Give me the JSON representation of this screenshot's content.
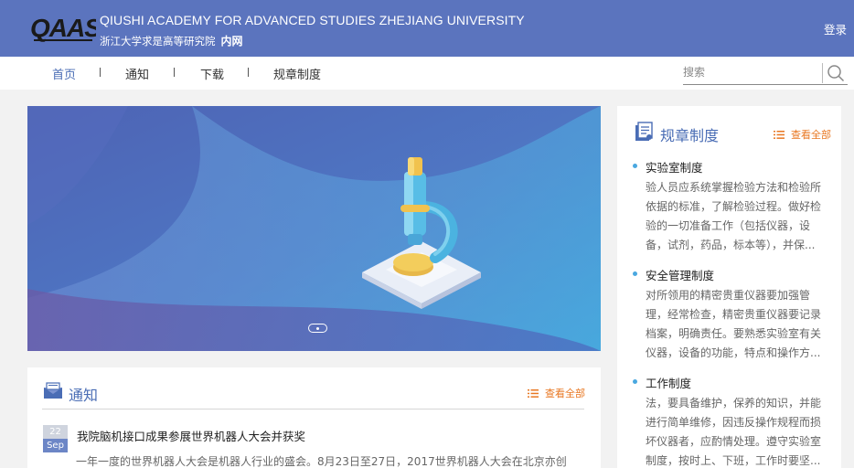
{
  "header": {
    "logo_text": "QAAS",
    "title_en": "QIUSHI ACADEMY FOR ADVANCED STUDIES ZHEJIANG UNIVERSITY",
    "title_cn": "浙江大学求是高等研究院",
    "badge": "内网",
    "login_label": "登录"
  },
  "nav": {
    "items": [
      {
        "label": "首页",
        "active": true
      },
      {
        "label": "通知",
        "active": false
      },
      {
        "label": "下载",
        "active": false
      },
      {
        "label": "规章制度",
        "active": false
      }
    ],
    "search_placeholder": "搜索",
    "search_icon": "search-icon"
  },
  "banner": {
    "illustration": "microscope",
    "slide_indicator_active": 1
  },
  "notice": {
    "title": "通知",
    "more_label": "查看全部",
    "items": [
      {
        "day": "22",
        "month": "Sep",
        "title": "我院脑机接口成果参展世界机器人大会并获奖",
        "summary": "一年一度的世界机器人大会是机器人行业的盛会。8月23日至27日，2017世界机器人大会在北京亦创"
      }
    ]
  },
  "rules": {
    "title": "规章制度",
    "more_label": "查看全部",
    "items": [
      {
        "title": "实验室制度",
        "lines": [
          "验人员应系统掌握检验方法和检验所",
          "依据的标准，了解检验过程。做好检",
          "验的一切准备工作（包括仪器，设",
          "备，试剂，药品，标本等），并保..."
        ]
      },
      {
        "title": "安全管理制度",
        "lines": [
          "对所领用的精密贵重仪器要加强管",
          "理，经常检查，精密贵重仪器要记录",
          "档案，明确责任。要熟悉实验室有关",
          "仪器，设备的功能，特点和操作方..."
        ]
      },
      {
        "title": "工作制度",
        "lines": [
          "法，要具备维护，保养的知识，并能",
          "进行简单维修，因违反操作规程而损",
          "坏仪器者，应酌情处理。遵守实验室",
          "制度，按时上、下班，工作时要坚..."
        ]
      }
    ]
  },
  "colors": {
    "header_bg": "#5b74be",
    "accent": "#4a6db5",
    "more_link": "#e87722",
    "bullet": "#4aa8e0"
  }
}
